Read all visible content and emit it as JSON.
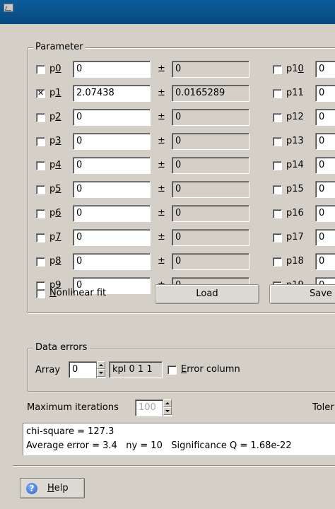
{
  "parameter_group": {
    "title": "Parameter",
    "left_rows": [
      {
        "name": "p",
        "digit": "0",
        "value": "0",
        "error": "0",
        "checked": false
      },
      {
        "name": "p",
        "digit": "1",
        "value": "2.07438",
        "error": "0.0165289",
        "checked": true
      },
      {
        "name": "p",
        "digit": "2",
        "value": "0",
        "error": "0",
        "checked": false
      },
      {
        "name": "p",
        "digit": "3",
        "value": "0",
        "error": "0",
        "checked": false
      },
      {
        "name": "p",
        "digit": "4",
        "value": "0",
        "error": "0",
        "checked": false
      },
      {
        "name": "p",
        "digit": "5",
        "value": "0",
        "error": "0",
        "checked": false
      },
      {
        "name": "p",
        "digit": "6",
        "value": "0",
        "error": "0",
        "checked": false
      },
      {
        "name": "p",
        "digit": "7",
        "value": "0",
        "error": "0",
        "checked": false
      },
      {
        "name": "p",
        "digit": "8",
        "value": "0",
        "error": "0",
        "checked": false
      },
      {
        "name": "p",
        "digit": "9",
        "value": "0",
        "error": "0",
        "checked": false
      }
    ],
    "right_rows": [
      {
        "prefix": "p1",
        "digit": "0",
        "value": "0",
        "checked": false
      },
      {
        "prefix": "p11",
        "digit": "",
        "value": "0",
        "checked": false
      },
      {
        "prefix": "p12",
        "digit": "",
        "value": "0",
        "checked": false
      },
      {
        "prefix": "p13",
        "digit": "",
        "value": "0",
        "checked": false
      },
      {
        "prefix": "p14",
        "digit": "",
        "value": "0",
        "checked": false
      },
      {
        "prefix": "p15",
        "digit": "",
        "value": "0",
        "checked": false
      },
      {
        "prefix": "p16",
        "digit": "",
        "value": "0",
        "checked": false
      },
      {
        "prefix": "p17",
        "digit": "",
        "value": "0",
        "checked": false
      },
      {
        "prefix": "p18",
        "digit": "",
        "value": "0",
        "checked": false
      },
      {
        "prefix": "p19",
        "digit": "",
        "value": "0",
        "checked": false
      }
    ],
    "pm_symbol": "±",
    "nonlinear_label": "Nonlinear fit",
    "load_label": "Load",
    "save_label": "Save"
  },
  "data_errors": {
    "title": "Data errors",
    "array_label": "Array",
    "array_value": "0",
    "kpl_text": "kpl 0 1 1",
    "error_column_label": "Error column"
  },
  "max_iterations_label": "Maximum iterations",
  "max_iterations_value": "100",
  "tolerance_label": "Toler",
  "results": {
    "line1": "chi-square = 127.3",
    "line2": "Average error = 3.4   ny = 10   Significance Q = 1.68e-22"
  },
  "help_label": "Help",
  "colors": {
    "titlebar": "#0a5c9a",
    "window_bg": "#d4d0c8",
    "help_icon": "#2a5fc6"
  }
}
